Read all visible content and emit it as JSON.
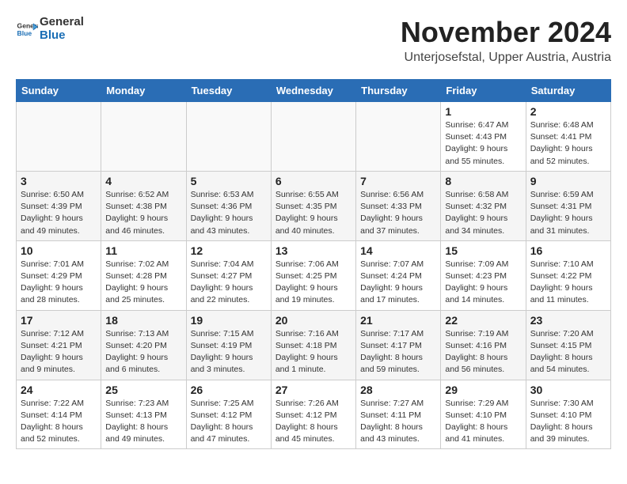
{
  "logo": {
    "line1": "General",
    "line2": "Blue"
  },
  "title": "November 2024",
  "subtitle": "Unterjosefstal, Upper Austria, Austria",
  "days_of_week": [
    "Sunday",
    "Monday",
    "Tuesday",
    "Wednesday",
    "Thursday",
    "Friday",
    "Saturday"
  ],
  "weeks": [
    [
      {
        "day": "",
        "info": ""
      },
      {
        "day": "",
        "info": ""
      },
      {
        "day": "",
        "info": ""
      },
      {
        "day": "",
        "info": ""
      },
      {
        "day": "",
        "info": ""
      },
      {
        "day": "1",
        "info": "Sunrise: 6:47 AM\nSunset: 4:43 PM\nDaylight: 9 hours and 55 minutes."
      },
      {
        "day": "2",
        "info": "Sunrise: 6:48 AM\nSunset: 4:41 PM\nDaylight: 9 hours and 52 minutes."
      }
    ],
    [
      {
        "day": "3",
        "info": "Sunrise: 6:50 AM\nSunset: 4:39 PM\nDaylight: 9 hours and 49 minutes."
      },
      {
        "day": "4",
        "info": "Sunrise: 6:52 AM\nSunset: 4:38 PM\nDaylight: 9 hours and 46 minutes."
      },
      {
        "day": "5",
        "info": "Sunrise: 6:53 AM\nSunset: 4:36 PM\nDaylight: 9 hours and 43 minutes."
      },
      {
        "day": "6",
        "info": "Sunrise: 6:55 AM\nSunset: 4:35 PM\nDaylight: 9 hours and 40 minutes."
      },
      {
        "day": "7",
        "info": "Sunrise: 6:56 AM\nSunset: 4:33 PM\nDaylight: 9 hours and 37 minutes."
      },
      {
        "day": "8",
        "info": "Sunrise: 6:58 AM\nSunset: 4:32 PM\nDaylight: 9 hours and 34 minutes."
      },
      {
        "day": "9",
        "info": "Sunrise: 6:59 AM\nSunset: 4:31 PM\nDaylight: 9 hours and 31 minutes."
      }
    ],
    [
      {
        "day": "10",
        "info": "Sunrise: 7:01 AM\nSunset: 4:29 PM\nDaylight: 9 hours and 28 minutes."
      },
      {
        "day": "11",
        "info": "Sunrise: 7:02 AM\nSunset: 4:28 PM\nDaylight: 9 hours and 25 minutes."
      },
      {
        "day": "12",
        "info": "Sunrise: 7:04 AM\nSunset: 4:27 PM\nDaylight: 9 hours and 22 minutes."
      },
      {
        "day": "13",
        "info": "Sunrise: 7:06 AM\nSunset: 4:25 PM\nDaylight: 9 hours and 19 minutes."
      },
      {
        "day": "14",
        "info": "Sunrise: 7:07 AM\nSunset: 4:24 PM\nDaylight: 9 hours and 17 minutes."
      },
      {
        "day": "15",
        "info": "Sunrise: 7:09 AM\nSunset: 4:23 PM\nDaylight: 9 hours and 14 minutes."
      },
      {
        "day": "16",
        "info": "Sunrise: 7:10 AM\nSunset: 4:22 PM\nDaylight: 9 hours and 11 minutes."
      }
    ],
    [
      {
        "day": "17",
        "info": "Sunrise: 7:12 AM\nSunset: 4:21 PM\nDaylight: 9 hours and 9 minutes."
      },
      {
        "day": "18",
        "info": "Sunrise: 7:13 AM\nSunset: 4:20 PM\nDaylight: 9 hours and 6 minutes."
      },
      {
        "day": "19",
        "info": "Sunrise: 7:15 AM\nSunset: 4:19 PM\nDaylight: 9 hours and 3 minutes."
      },
      {
        "day": "20",
        "info": "Sunrise: 7:16 AM\nSunset: 4:18 PM\nDaylight: 9 hours and 1 minute."
      },
      {
        "day": "21",
        "info": "Sunrise: 7:17 AM\nSunset: 4:17 PM\nDaylight: 8 hours and 59 minutes."
      },
      {
        "day": "22",
        "info": "Sunrise: 7:19 AM\nSunset: 4:16 PM\nDaylight: 8 hours and 56 minutes."
      },
      {
        "day": "23",
        "info": "Sunrise: 7:20 AM\nSunset: 4:15 PM\nDaylight: 8 hours and 54 minutes."
      }
    ],
    [
      {
        "day": "24",
        "info": "Sunrise: 7:22 AM\nSunset: 4:14 PM\nDaylight: 8 hours and 52 minutes."
      },
      {
        "day": "25",
        "info": "Sunrise: 7:23 AM\nSunset: 4:13 PM\nDaylight: 8 hours and 49 minutes."
      },
      {
        "day": "26",
        "info": "Sunrise: 7:25 AM\nSunset: 4:12 PM\nDaylight: 8 hours and 47 minutes."
      },
      {
        "day": "27",
        "info": "Sunrise: 7:26 AM\nSunset: 4:12 PM\nDaylight: 8 hours and 45 minutes."
      },
      {
        "day": "28",
        "info": "Sunrise: 7:27 AM\nSunset: 4:11 PM\nDaylight: 8 hours and 43 minutes."
      },
      {
        "day": "29",
        "info": "Sunrise: 7:29 AM\nSunset: 4:10 PM\nDaylight: 8 hours and 41 minutes."
      },
      {
        "day": "30",
        "info": "Sunrise: 7:30 AM\nSunset: 4:10 PM\nDaylight: 8 hours and 39 minutes."
      }
    ]
  ]
}
